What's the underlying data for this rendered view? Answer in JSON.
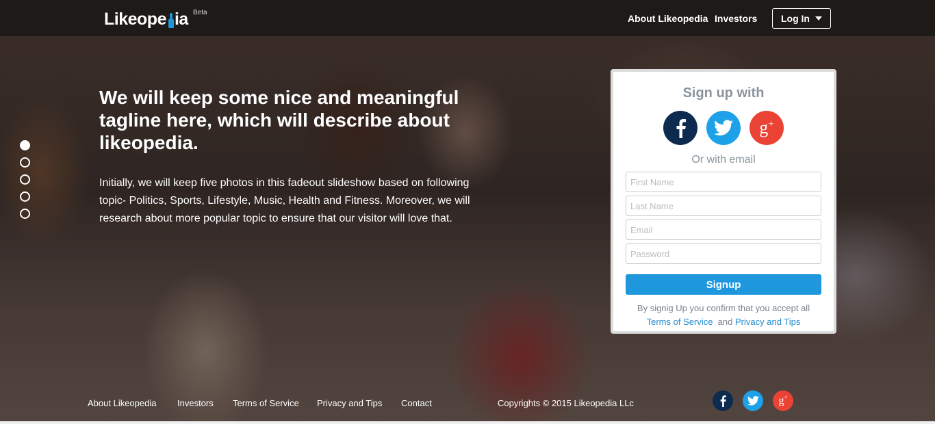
{
  "header": {
    "logo_text_left": "Likeope",
    "logo_text_right": "ia",
    "logo_beta": "Beta",
    "nav": [
      "About Likeopedia",
      "Investors"
    ],
    "login_label": "Log In"
  },
  "hero": {
    "tagline": "We will keep some nice and meaningful tagline here, which will describe about likeopedia.",
    "body": "Initially, we will keep five photos in this fadeout slideshow based on following topic- Politics, Sports, Lifestyle, Music, Health and Fitness. Moreover, we will research about more popular topic to ensure that our visitor will love that.",
    "slides_total": 5,
    "active_slide": 1
  },
  "signup": {
    "title": "Sign up with",
    "or_email": "Or with email",
    "first_name_placeholder": "First Name",
    "last_name_placeholder": "Last Name",
    "email_placeholder": "Email",
    "password_placeholder": "Password",
    "button_label": "Signup",
    "terms_prefix": "By signig Up you confirm that you accept all",
    "terms_link": "Terms of Service",
    "terms_and": "and",
    "privacy_link": "Privacy and Tips"
  },
  "footer": {
    "links": [
      "About Likeopedia",
      "Investors",
      "Terms of Service",
      "Privacy and Tips",
      "Contact"
    ],
    "copyright": "Copyrights © 2015 Likeopedia LLc"
  },
  "colors": {
    "facebook": "#0d2a4f",
    "twitter": "#1da1e8",
    "google": "#ea4335",
    "accent": "#1f97dd"
  }
}
